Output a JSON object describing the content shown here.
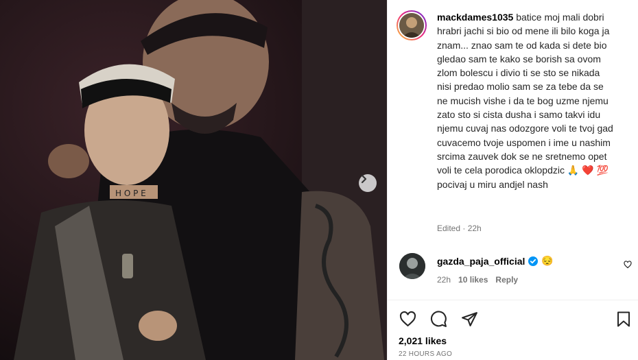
{
  "post": {
    "username": "mackdames1035",
    "caption": "batice moj mali dobri hrabri jachi si bio od mene ili bilo koga ja znam... znao sam te od kada si dete bio gledao sam te kako se borish sa ovom zlom bolescu i divio ti se sto se nikada nisi predao molio sam se za tebe da se ne mucish vishe i da te bog uzme njemu zato sto si cista dusha i samo takvi idu njemu cuvaj nas odozgore voli te tvoj gad cuvacemo tvoje uspomen i ime u nashim srcima zauvek dok se ne sretnemo opet voli te cela porodica oklopdzic 🙏 ❤️ 💯 pocivaj u miru andjel nash",
    "edited": "Edited · 22h",
    "likes": "2,021 likes",
    "time_ago": "22 HOURS AGO"
  },
  "comment": {
    "username": "gazda_paja_official",
    "text": "😔",
    "time": "22h",
    "likes": "10 likes",
    "reply_label": "Reply"
  },
  "icons": {
    "next": "chevron-right-icon",
    "like": "heart-icon",
    "comment": "comment-icon",
    "share": "share-icon",
    "save": "bookmark-icon",
    "verified": "verified-badge-icon"
  },
  "colors": {
    "text_primary": "#000000",
    "text_secondary": "#737373",
    "verified": "#0095f6",
    "divider": "#efefef"
  }
}
